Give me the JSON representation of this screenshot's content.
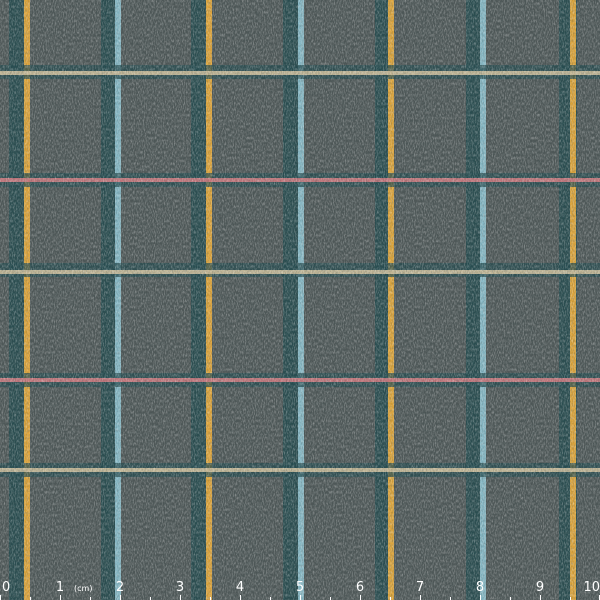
{
  "ruler": {
    "labels": [
      "0",
      "1",
      "2",
      "3",
      "4",
      "5",
      "6",
      "7",
      "8",
      "9",
      "10"
    ],
    "unit": "(cm)"
  },
  "colors": {
    "base": "#4f5858",
    "dark_band": "#264c50",
    "light_blue": "#8fc3d0",
    "gold": "#e6a93a",
    "pink": "#d07a80",
    "cream": "#d8c6a0",
    "ruler_text": "#ffffff"
  }
}
